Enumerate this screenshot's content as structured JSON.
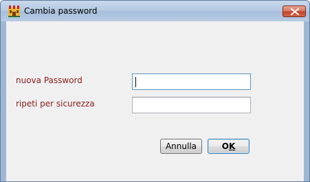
{
  "window": {
    "title": "Cambia password",
    "icon": "app-castle-icon",
    "close_icon": "close-icon"
  },
  "form": {
    "new_password_label": "nuova Password",
    "new_password_value": "",
    "repeat_label": "ripeti per sicurezza",
    "repeat_value": ""
  },
  "buttons": {
    "cancel_label": "Annulla",
    "ok_label_prefix": "O",
    "ok_label_underlined": "K"
  },
  "colors": {
    "label_color": "#8b1a1a",
    "close_button_red": "#c2432a"
  }
}
